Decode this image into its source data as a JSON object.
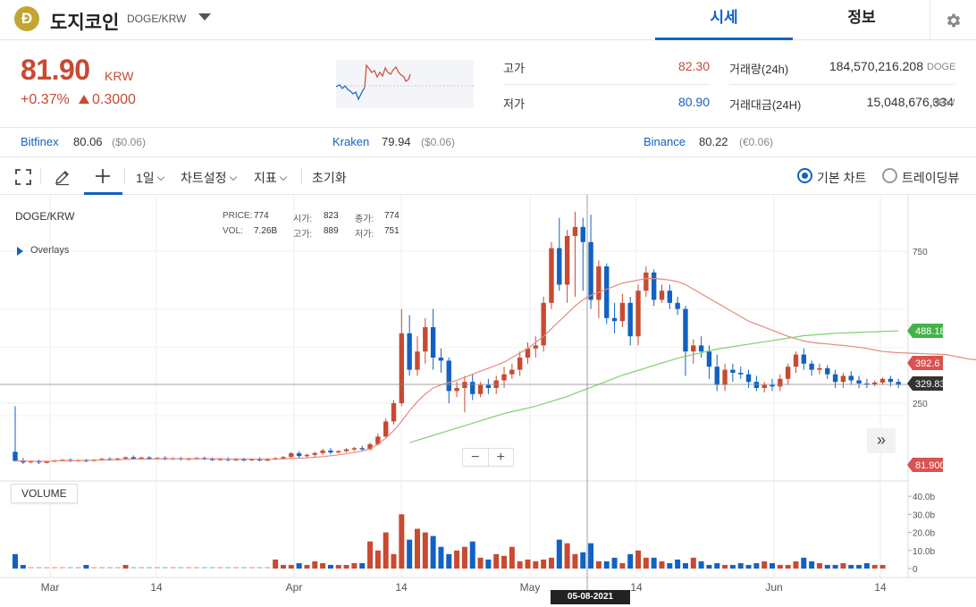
{
  "header": {
    "coin_logo_letter": "Ð",
    "coin_name": "도지코인",
    "pair": "DOGE/KRW",
    "tabs": [
      {
        "label": "시세",
        "active": true
      },
      {
        "label": "정보",
        "active": false
      }
    ]
  },
  "summary": {
    "price": "81.90",
    "price_unit": "KRW",
    "change_pct": "+0.37%",
    "change_abs": "0.3000",
    "high_label": "고가",
    "high_value": "82.30",
    "low_label": "저가",
    "low_value": "80.90",
    "volume_label": "거래량(24h)",
    "volume_value": "184,570,216.208",
    "volume_unit": "DOGE",
    "amount_label": "거래대금(24H)",
    "amount_value": "15,048,676,334",
    "amount_unit": "KRW"
  },
  "exchanges": [
    {
      "name": "Bitfinex",
      "price": "80.06",
      "converted": "($0.06)"
    },
    {
      "name": "Kraken",
      "price": "79.94",
      "converted": "($0.06)"
    },
    {
      "name": "Binance",
      "price": "80.22",
      "converted": "(€0.06)"
    }
  ],
  "toolbar": {
    "interval": "1일",
    "chart_settings": "차트설정",
    "indicators": "지표",
    "reset": "초기화",
    "basic_chart": "기본 차트",
    "trading_view": "트레이딩뷰",
    "selected_view": "basic_chart"
  },
  "chart": {
    "symbol": "DOGE/KRW",
    "overlays_label": "Overlays",
    "ohlc": {
      "price_label": "PRICE:",
      "price": "774",
      "vol_label": "VOL:",
      "vol": "7.26B",
      "open_label": "시가:",
      "open": "823",
      "high_label": "고가:",
      "high": "889",
      "close_label": "종가:",
      "close": "774",
      "low_label": "저가:",
      "low": "751"
    },
    "y_ticks": [
      "750",
      "250"
    ],
    "volume_ticks": [
      "40.0b",
      "30.0b",
      "20.0b",
      "10.0b",
      "0"
    ],
    "x_ticks": [
      "Mar",
      "14",
      "Apr",
      "14",
      "May",
      "14",
      "Jun",
      "14"
    ],
    "price_tags": {
      "ma_long": "488.18",
      "ma_short": "392.6",
      "crosshair": "329.83",
      "last": "81.900"
    },
    "volume_label": "VOLUME",
    "crosshair_date": "05-08-2021",
    "zoom_out": "−",
    "zoom_in": "+",
    "jump_label": "»"
  },
  "colors": {
    "up": "#c84a31",
    "down": "#1261c4",
    "ma_short": "#e8897d",
    "ma_long": "#7dd36b",
    "accent": "#1261c4"
  },
  "chart_data": {
    "type": "candlestick",
    "axis_price_range": [
      0,
      900
    ],
    "candles": [
      {
        "o": 90,
        "h": 240,
        "c": 60,
        "l": 58
      },
      {
        "o": 62,
        "h": 70,
        "c": 55,
        "l": 50
      },
      {
        "o": 55,
        "h": 62,
        "c": 60,
        "l": 52
      },
      {
        "o": 60,
        "h": 64,
        "c": 55,
        "l": 50
      },
      {
        "o": 55,
        "h": 60,
        "c": 58,
        "l": 52
      },
      {
        "o": 58,
        "h": 64,
        "c": 62,
        "l": 55
      },
      {
        "o": 62,
        "h": 66,
        "c": 64,
        "l": 58
      },
      {
        "o": 64,
        "h": 68,
        "c": 60,
        "l": 56
      },
      {
        "o": 60,
        "h": 65,
        "c": 63,
        "l": 57
      },
      {
        "o": 63,
        "h": 67,
        "c": 60,
        "l": 56
      },
      {
        "o": 60,
        "h": 66,
        "c": 64,
        "l": 58
      },
      {
        "o": 64,
        "h": 70,
        "c": 67,
        "l": 60
      },
      {
        "o": 67,
        "h": 72,
        "c": 64,
        "l": 60
      },
      {
        "o": 64,
        "h": 70,
        "c": 68,
        "l": 60
      },
      {
        "o": 68,
        "h": 74,
        "c": 72,
        "l": 64
      },
      {
        "o": 72,
        "h": 78,
        "c": 69,
        "l": 64
      },
      {
        "o": 69,
        "h": 74,
        "c": 71,
        "l": 65
      },
      {
        "o": 71,
        "h": 76,
        "c": 68,
        "l": 63
      },
      {
        "o": 68,
        "h": 73,
        "c": 70,
        "l": 64
      },
      {
        "o": 70,
        "h": 75,
        "c": 67,
        "l": 62
      },
      {
        "o": 67,
        "h": 72,
        "c": 69,
        "l": 63
      },
      {
        "o": 69,
        "h": 74,
        "c": 66,
        "l": 61
      },
      {
        "o": 66,
        "h": 71,
        "c": 68,
        "l": 62
      },
      {
        "o": 68,
        "h": 73,
        "c": 70,
        "l": 64
      },
      {
        "o": 70,
        "h": 74,
        "c": 67,
        "l": 62
      },
      {
        "o": 67,
        "h": 72,
        "c": 65,
        "l": 60
      },
      {
        "o": 65,
        "h": 70,
        "c": 67,
        "l": 61
      },
      {
        "o": 67,
        "h": 72,
        "c": 64,
        "l": 59
      },
      {
        "o": 64,
        "h": 70,
        "c": 66,
        "l": 60
      },
      {
        "o": 66,
        "h": 71,
        "c": 64,
        "l": 59
      },
      {
        "o": 64,
        "h": 69,
        "c": 66,
        "l": 60
      },
      {
        "o": 66,
        "h": 72,
        "c": 64,
        "l": 59
      },
      {
        "o": 64,
        "h": 70,
        "c": 65,
        "l": 60
      },
      {
        "o": 65,
        "h": 72,
        "c": 69,
        "l": 62
      },
      {
        "o": 69,
        "h": 76,
        "c": 73,
        "l": 64
      },
      {
        "o": 73,
        "h": 90,
        "c": 85,
        "l": 68
      },
      {
        "o": 85,
        "h": 92,
        "c": 76,
        "l": 70
      },
      {
        "o": 76,
        "h": 84,
        "c": 80,
        "l": 72
      },
      {
        "o": 80,
        "h": 90,
        "c": 86,
        "l": 74
      },
      {
        "o": 86,
        "h": 100,
        "c": 94,
        "l": 80
      },
      {
        "o": 94,
        "h": 102,
        "c": 88,
        "l": 82
      },
      {
        "o": 88,
        "h": 96,
        "c": 92,
        "l": 84
      },
      {
        "o": 92,
        "h": 102,
        "c": 98,
        "l": 88
      },
      {
        "o": 98,
        "h": 106,
        "c": 102,
        "l": 92
      },
      {
        "o": 102,
        "h": 110,
        "c": 98,
        "l": 94
      },
      {
        "o": 98,
        "h": 120,
        "c": 115,
        "l": 95
      },
      {
        "o": 115,
        "h": 150,
        "c": 140,
        "l": 110
      },
      {
        "o": 140,
        "h": 200,
        "c": 190,
        "l": 135
      },
      {
        "o": 190,
        "h": 260,
        "c": 250,
        "l": 180
      },
      {
        "o": 250,
        "h": 560,
        "c": 480,
        "l": 240
      },
      {
        "o": 480,
        "h": 540,
        "c": 360,
        "l": 340
      },
      {
        "o": 360,
        "h": 470,
        "c": 420,
        "l": 340
      },
      {
        "o": 420,
        "h": 530,
        "c": 500,
        "l": 380
      },
      {
        "o": 500,
        "h": 560,
        "c": 400,
        "l": 360
      },
      {
        "o": 400,
        "h": 430,
        "c": 390,
        "l": 350
      },
      {
        "o": 390,
        "h": 400,
        "c": 290,
        "l": 250
      },
      {
        "o": 290,
        "h": 320,
        "c": 300,
        "l": 270
      },
      {
        "o": 300,
        "h": 340,
        "c": 320,
        "l": 220
      },
      {
        "o": 320,
        "h": 345,
        "c": 280,
        "l": 260
      },
      {
        "o": 280,
        "h": 320,
        "c": 310,
        "l": 270
      },
      {
        "o": 310,
        "h": 330,
        "c": 300,
        "l": 280
      },
      {
        "o": 300,
        "h": 340,
        "c": 325,
        "l": 280
      },
      {
        "o": 325,
        "h": 370,
        "c": 345,
        "l": 300
      },
      {
        "o": 345,
        "h": 380,
        "c": 360,
        "l": 330
      },
      {
        "o": 360,
        "h": 420,
        "c": 400,
        "l": 340
      },
      {
        "o": 400,
        "h": 450,
        "c": 430,
        "l": 380
      },
      {
        "o": 430,
        "h": 470,
        "c": 440,
        "l": 400
      },
      {
        "o": 440,
        "h": 600,
        "c": 580,
        "l": 420
      },
      {
        "o": 580,
        "h": 780,
        "c": 760,
        "l": 560
      },
      {
        "o": 760,
        "h": 860,
        "c": 640,
        "l": 620
      },
      {
        "o": 640,
        "h": 820,
        "c": 800,
        "l": 580
      },
      {
        "o": 800,
        "h": 880,
        "c": 830,
        "l": 600
      },
      {
        "o": 830,
        "h": 860,
        "c": 780,
        "l": 620
      },
      {
        "o": 780,
        "h": 870,
        "c": 590,
        "l": 560
      },
      {
        "o": 590,
        "h": 720,
        "c": 700,
        "l": 530
      },
      {
        "o": 700,
        "h": 710,
        "c": 530,
        "l": 510
      },
      {
        "o": 530,
        "h": 580,
        "c": 520,
        "l": 480
      },
      {
        "o": 520,
        "h": 610,
        "c": 580,
        "l": 500
      },
      {
        "o": 580,
        "h": 600,
        "c": 470,
        "l": 440
      },
      {
        "o": 470,
        "h": 640,
        "c": 620,
        "l": 440
      },
      {
        "o": 620,
        "h": 700,
        "c": 680,
        "l": 600
      },
      {
        "o": 680,
        "h": 690,
        "c": 590,
        "l": 570
      },
      {
        "o": 590,
        "h": 640,
        "c": 620,
        "l": 580
      },
      {
        "o": 620,
        "h": 640,
        "c": 580,
        "l": 560
      },
      {
        "o": 580,
        "h": 600,
        "c": 560,
        "l": 540
      },
      {
        "o": 560,
        "h": 570,
        "c": 420,
        "l": 340
      },
      {
        "o": 420,
        "h": 460,
        "c": 440,
        "l": 380
      },
      {
        "o": 440,
        "h": 470,
        "c": 420,
        "l": 400
      },
      {
        "o": 420,
        "h": 440,
        "c": 370,
        "l": 330
      },
      {
        "o": 370,
        "h": 410,
        "c": 310,
        "l": 290
      },
      {
        "o": 310,
        "h": 380,
        "c": 360,
        "l": 290
      },
      {
        "o": 360,
        "h": 380,
        "c": 350,
        "l": 320
      },
      {
        "o": 350,
        "h": 370,
        "c": 345,
        "l": 330
      },
      {
        "o": 345,
        "h": 360,
        "c": 320,
        "l": 300
      },
      {
        "o": 320,
        "h": 340,
        "c": 300,
        "l": 290
      },
      {
        "o": 300,
        "h": 320,
        "c": 310,
        "l": 285
      },
      {
        "o": 310,
        "h": 330,
        "c": 305,
        "l": 290
      },
      {
        "o": 305,
        "h": 345,
        "c": 330,
        "l": 290
      },
      {
        "o": 330,
        "h": 380,
        "c": 370,
        "l": 310
      },
      {
        "o": 370,
        "h": 420,
        "c": 410,
        "l": 350
      },
      {
        "o": 410,
        "h": 430,
        "c": 380,
        "l": 360
      },
      {
        "o": 380,
        "h": 390,
        "c": 360,
        "l": 340
      },
      {
        "o": 360,
        "h": 380,
        "c": 365,
        "l": 345
      },
      {
        "o": 365,
        "h": 375,
        "c": 345,
        "l": 330
      },
      {
        "o": 345,
        "h": 360,
        "c": 320,
        "l": 300
      },
      {
        "o": 320,
        "h": 350,
        "c": 340,
        "l": 300
      },
      {
        "o": 340,
        "h": 355,
        "c": 325,
        "l": 310
      },
      {
        "o": 325,
        "h": 340,
        "c": 315,
        "l": 300
      },
      {
        "o": 315,
        "h": 330,
        "c": 312,
        "l": 300
      },
      {
        "o": 312,
        "h": 325,
        "c": 318,
        "l": 305
      },
      {
        "o": 318,
        "h": 335,
        "c": 330,
        "l": 310
      },
      {
        "o": 330,
        "h": 340,
        "c": 320,
        "l": 305
      },
      {
        "o": 320,
        "h": 330,
        "c": 310,
        "l": 300
      }
    ],
    "volume_series": [
      8,
      2,
      1,
      1,
      1,
      1,
      1,
      1,
      1,
      2,
      1,
      1,
      1,
      1,
      2,
      1,
      1,
      1,
      1,
      1,
      1,
      1,
      1,
      1,
      1,
      1,
      1,
      1,
      1,
      1,
      1,
      1,
      1,
      5,
      2,
      2,
      3,
      2,
      4,
      3,
      2,
      2,
      2,
      3,
      3,
      15,
      10,
      20,
      8,
      30,
      16,
      22,
      20,
      18,
      12,
      8,
      10,
      12,
      15,
      6,
      5,
      8,
      7,
      12,
      4,
      5,
      4,
      5,
      6,
      16,
      14,
      8,
      9,
      14,
      4,
      4,
      6,
      3,
      8,
      10,
      6,
      6,
      4,
      3,
      5,
      3,
      6,
      4,
      2,
      3,
      2,
      2,
      3,
      2,
      3,
      4,
      3,
      2,
      2,
      4,
      6,
      4,
      3,
      2,
      2,
      3,
      2,
      2,
      3,
      2,
      2
    ],
    "ma_short": [
      60,
      60,
      59,
      59,
      59,
      60,
      61,
      61,
      61,
      62,
      62,
      63,
      64,
      64,
      65,
      66,
      66,
      66,
      67,
      67,
      67,
      67,
      67,
      67,
      67,
      67,
      67,
      66,
      66,
      66,
      66,
      66,
      66,
      66,
      67,
      68,
      69,
      70,
      72,
      74,
      77,
      80,
      84,
      88,
      92,
      100,
      115,
      135,
      160,
      190,
      225,
      255,
      280,
      300,
      310,
      318,
      325,
      335,
      345,
      355,
      365,
      375,
      385,
      400,
      415,
      430,
      450,
      470,
      495,
      520,
      545,
      570,
      590,
      605,
      615,
      625,
      635,
      645,
      650,
      655,
      660,
      660,
      658,
      655,
      650,
      640,
      625,
      610,
      595,
      580,
      565,
      550,
      535,
      520,
      510,
      500,
      490,
      480,
      470,
      462,
      455,
      450,
      447,
      445,
      442,
      440,
      437,
      434,
      430,
      425,
      420,
      418,
      416,
      415,
      414,
      413,
      412,
      411,
      410,
      405,
      400,
      395,
      392.6
    ],
    "ma_long": [
      120,
      128,
      136,
      144,
      152,
      160,
      168,
      176,
      184,
      192,
      200,
      208,
      216,
      222,
      228,
      234,
      240,
      248,
      256,
      264,
      272,
      282,
      292,
      302,
      312,
      322,
      332,
      342,
      350,
      358,
      366,
      374,
      382,
      390,
      398,
      404,
      410,
      416,
      422,
      428,
      432,
      436,
      440,
      444,
      448,
      452,
      456,
      460,
      464,
      468,
      472,
      474,
      476,
      478,
      480,
      481,
      482,
      483,
      484,
      485,
      486,
      487,
      488.18
    ]
  }
}
